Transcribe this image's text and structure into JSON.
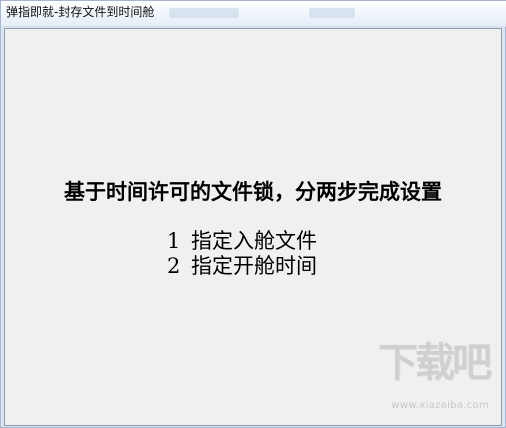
{
  "window": {
    "title": "弹指即就-封存文件到时间舱"
  },
  "content": {
    "headline": "基于时间许可的文件锁，分两步完成设置",
    "steps": [
      {
        "number": "1",
        "label": "指定入舱文件"
      },
      {
        "number": "2",
        "label": "指定开舱时间"
      }
    ]
  },
  "watermark": {
    "logo": "下载吧",
    "url": "www.xiazaiba.com"
  }
}
